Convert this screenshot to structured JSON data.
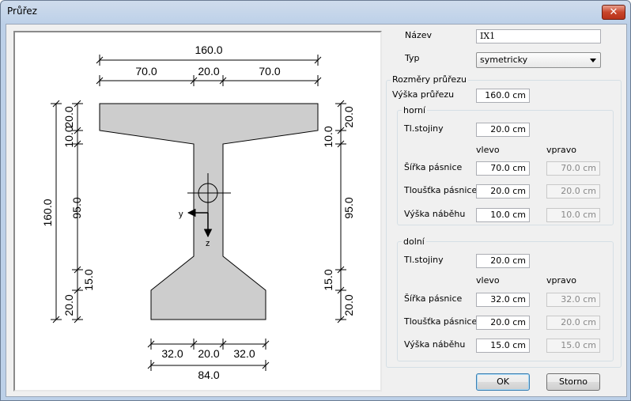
{
  "window": {
    "title": "Průřez",
    "close_glyph": "✕"
  },
  "drawing": {
    "dims_top": {
      "total": "160.0",
      "left": "70.0",
      "web": "20.0",
      "right": "70.0"
    },
    "dims_bottom": {
      "left": "32.0",
      "web": "20.0",
      "right": "32.0",
      "total": "84.0"
    },
    "dims_left": {
      "total": "160.0",
      "top_flange": "20.0",
      "top_haunch": "10.0",
      "web": "95.0",
      "bottom_haunch": "15.0",
      "bottom_flange": "20.0"
    },
    "dims_right": {
      "top_flange": "20.0",
      "top_haunch": "10.0",
      "web": "95.0",
      "bottom_haunch": "15.0",
      "bottom_flange": "20.0"
    },
    "axis_y": "y",
    "axis_z": "z"
  },
  "form": {
    "name_label": "Název",
    "name_value": "IX1",
    "type_label": "Typ",
    "type_value": "symetricky",
    "dims_group": "Rozměry průřezu",
    "height_label": "Výška průřezu",
    "height_value": "160.0 cm",
    "upper": {
      "title": "horní",
      "web_label": "Tl.stojiny",
      "web_value": "20.0 cm",
      "left_header": "vlevo",
      "right_header": "vpravo",
      "width_label": "Šířka pásnice",
      "width_left": "70.0 cm",
      "width_right": "70.0 cm",
      "thick_label": "Tloušťka pásnice",
      "thick_left": "20.0 cm",
      "thick_right": "20.0 cm",
      "haunch_label": "Výška náběhu",
      "haunch_left": "10.0 cm",
      "haunch_right": "10.0 cm"
    },
    "lower": {
      "title": "dolní",
      "web_label": "Tl.stojiny",
      "web_value": "20.0 cm",
      "left_header": "vlevo",
      "right_header": "vpravo",
      "width_label": "Šířka pásnice",
      "width_left": "32.0 cm",
      "width_right": "32.0 cm",
      "thick_label": "Tloušťka pásnice",
      "thick_left": "20.0 cm",
      "thick_right": "20.0 cm",
      "haunch_label": "Výška náběhu",
      "haunch_left": "15.0 cm",
      "haunch_right": "15.0 cm"
    }
  },
  "buttons": {
    "ok": "OK",
    "cancel": "Storno"
  }
}
